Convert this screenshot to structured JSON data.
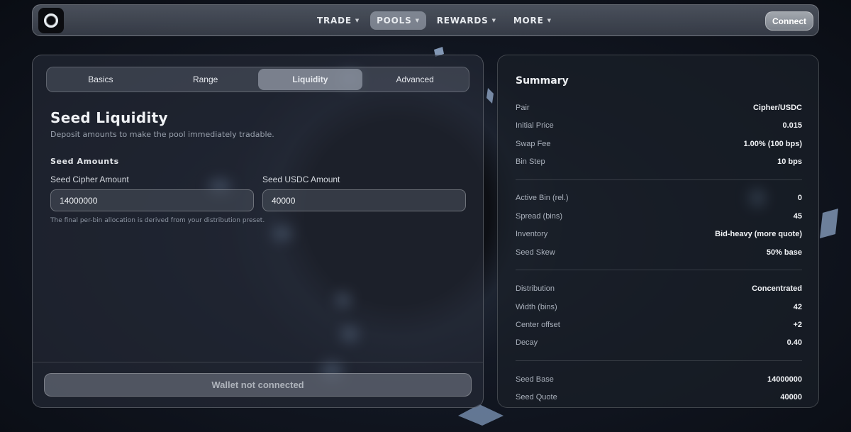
{
  "nav": {
    "items": [
      {
        "label": "TRADE",
        "active": false
      },
      {
        "label": "POOLS",
        "active": true
      },
      {
        "label": "REWARDS",
        "active": false
      },
      {
        "label": "MORE",
        "active": false
      }
    ],
    "caret_icon": "caret-down-icon",
    "connect_label": "Connect"
  },
  "tabs": [
    {
      "label": "Basics",
      "active": false
    },
    {
      "label": "Range",
      "active": false
    },
    {
      "label": "Liquidity",
      "active": true
    },
    {
      "label": "Advanced",
      "active": false
    }
  ],
  "liquidity": {
    "title": "Seed Liquidity",
    "description": "Deposit amounts to make the pool immediately tradable.",
    "subheading": "Seed Amounts",
    "base_label": "Seed Cipher Amount",
    "base_value": "14000000",
    "quote_label": "Seed USDC Amount",
    "quote_value": "40000",
    "hint": "The final per-bin allocation is derived from your distribution preset."
  },
  "wallet_button": "Wallet not connected",
  "summary": {
    "title": "Summary",
    "groups": [
      [
        {
          "label": "Pair",
          "value": "Cipher/USDC"
        },
        {
          "label": "Initial Price",
          "value": "0.015"
        },
        {
          "label": "Swap Fee",
          "value": "1.00% (100 bps)"
        },
        {
          "label": "Bin Step",
          "value": "10 bps"
        }
      ],
      [
        {
          "label": "Active Bin (rel.)",
          "value": "0"
        },
        {
          "label": "Spread (bins)",
          "value": "45"
        },
        {
          "label": "Inventory",
          "value": "Bid-heavy (more quote)"
        },
        {
          "label": "Seed Skew",
          "value": "50% base"
        }
      ],
      [
        {
          "label": "Distribution",
          "value": "Concentrated"
        },
        {
          "label": "Width (bins)",
          "value": "42"
        },
        {
          "label": "Center offset",
          "value": "+2"
        },
        {
          "label": "Decay",
          "value": "0.40"
        }
      ],
      [
        {
          "label": "Seed Base",
          "value": "14000000"
        },
        {
          "label": "Seed Quote",
          "value": "40000"
        }
      ]
    ]
  }
}
